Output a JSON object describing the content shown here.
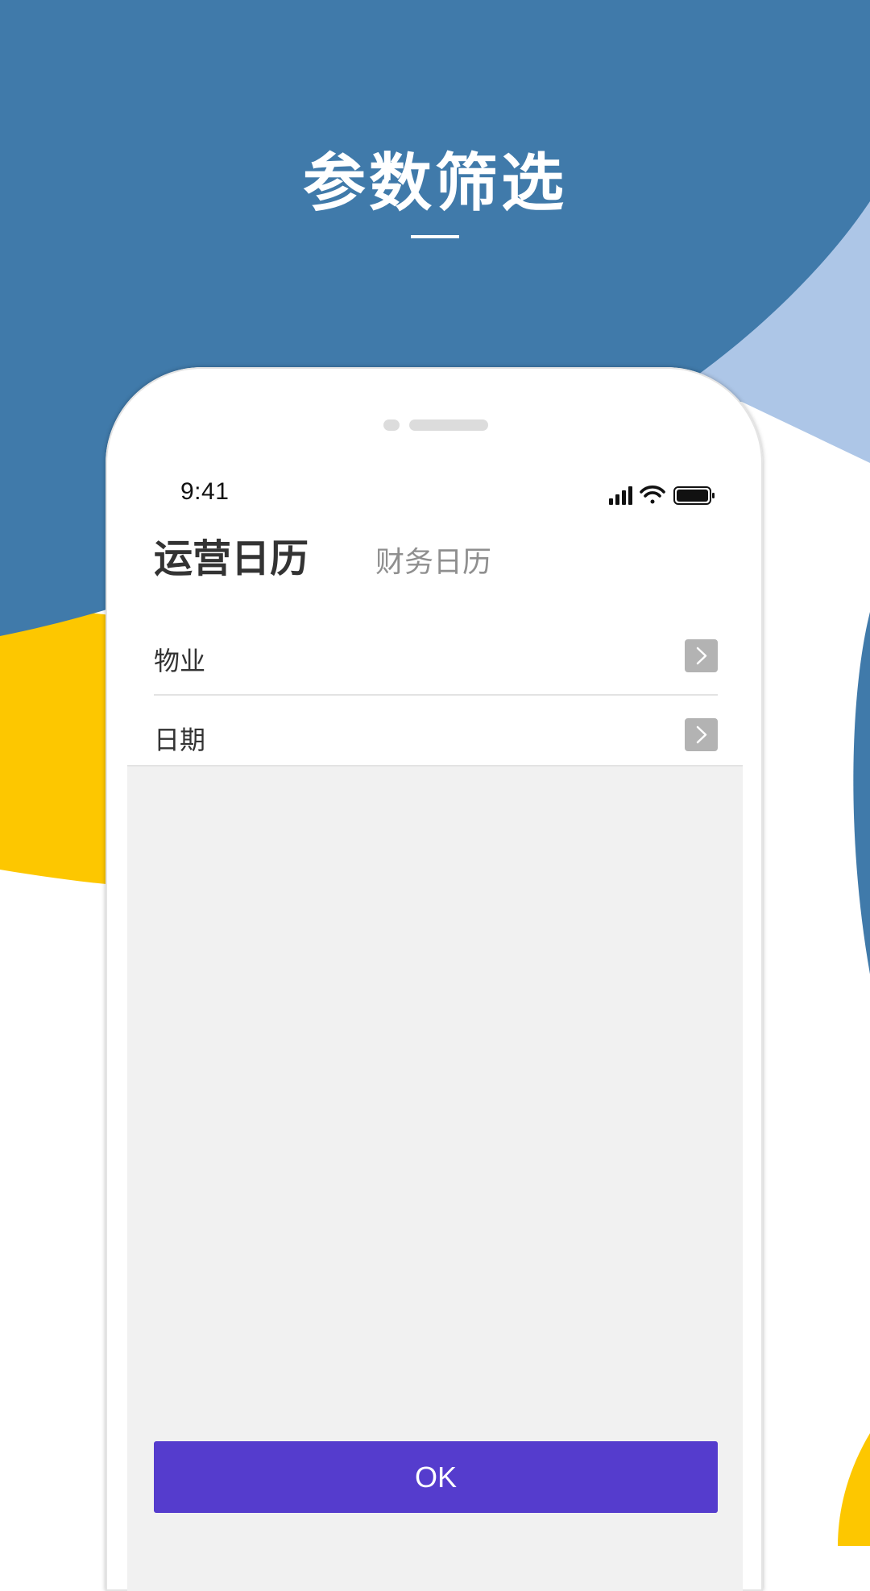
{
  "colors": {
    "background_blue": "#407aaa",
    "light_blue": "#adc6e7",
    "yellow": "#fdc700",
    "accent_purple": "#553ccd"
  },
  "promo": {
    "title": "参数筛选"
  },
  "status_bar": {
    "time": "9:41",
    "icons": [
      "cellular-signal-icon",
      "wifi-icon",
      "battery-icon"
    ]
  },
  "tabs": [
    {
      "label": "运营日历",
      "active": true
    },
    {
      "label": "财务日历",
      "active": false
    }
  ],
  "filters": [
    {
      "label": "物业",
      "icon": "chevron-right-icon"
    },
    {
      "label": "日期",
      "icon": "chevron-right-icon"
    }
  ],
  "actions": {
    "ok_label": "OK"
  }
}
